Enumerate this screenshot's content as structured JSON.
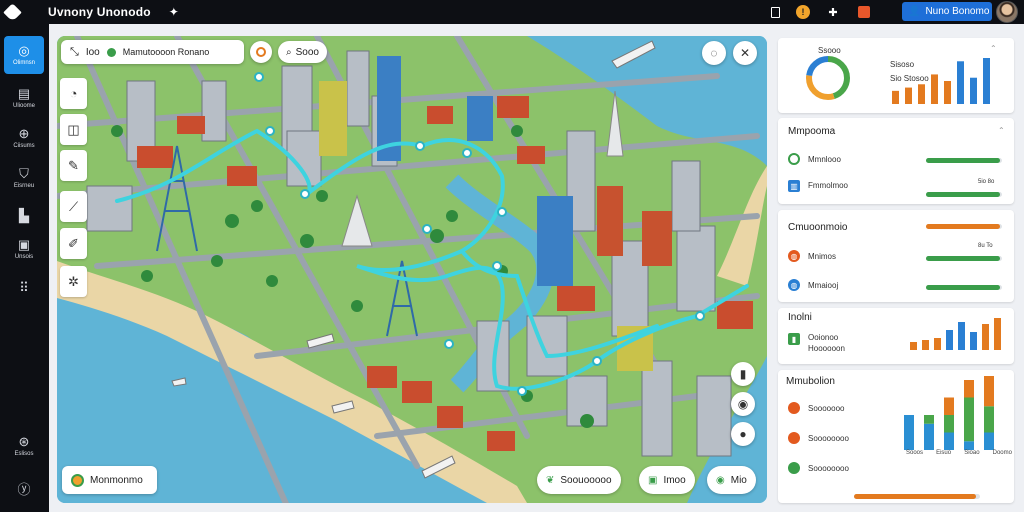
{
  "app": {
    "title": "Uvnony Unonodo",
    "star_icon": "sparkle-icon"
  },
  "topbar": {
    "icons": [
      "window-icon",
      "alert-icon",
      "puzzle-icon",
      "notification-icon"
    ],
    "user_label": "Nuno Bonomo"
  },
  "sidebar": {
    "items": [
      {
        "label": "Olimnsn",
        "icon": "target-icon",
        "active": true
      },
      {
        "label": "Ulioome",
        "icon": "book-icon"
      },
      {
        "label": "Ciisums",
        "icon": "globe-icon"
      },
      {
        "label": "Eisrneu",
        "icon": "shield-icon"
      },
      {
        "label": "",
        "icon": "bookmark-icon"
      },
      {
        "label": "Unsois",
        "icon": "box-icon"
      },
      {
        "label": "",
        "icon": "grid-icon"
      }
    ],
    "bottom": [
      {
        "label": "Eslisos",
        "icon": "settings-icon"
      },
      {
        "label": "",
        "icon": "help-icon"
      }
    ]
  },
  "map": {
    "toolbar": {
      "btn1": "Ioo",
      "location": "Mamutoooon Ronano",
      "search_label": "Sooo"
    },
    "bottom_left": "Monmonmo",
    "bottom_chips": [
      "Soouooooo",
      "Imoo",
      "Mio"
    ]
  },
  "panels": {
    "donut": {
      "label": "Ssooo",
      "stat": "Sisoso",
      "stat_sub": "Sio Stosoo",
      "values": [
        0.45,
        0.32,
        0.23
      ],
      "colors": [
        "#4aa64a",
        "#f0a02e",
        "#2a7fd3"
      ],
      "bars": [
        8,
        10,
        12,
        18,
        14,
        26,
        16,
        28
      ]
    },
    "metrics": {
      "title": "Mmpooma",
      "rows": [
        {
          "label": "Mmnlooo",
          "value": "",
          "progress": 0.98,
          "color": "#3a9d4a"
        },
        {
          "label": "Fmmolmoo",
          "value": "5io 8o",
          "progress": 0.98,
          "color": "#3a9d4a"
        }
      ]
    },
    "connections": {
      "title": "Cmuoonmoio",
      "rows": [
        {
          "label": "",
          "value": "",
          "progress": 0.98,
          "color": "#e37a1f"
        },
        {
          "label": "Mnimos",
          "value": "8u To",
          "progress": 0.98,
          "color": "#3a9d4a"
        },
        {
          "label": "Mmaiooj",
          "value": "",
          "progress": 0.98,
          "color": "#3a9d4a"
        }
      ]
    },
    "stats": {
      "title": "Inolni",
      "label": "Ooionoo",
      "sub": "Hoooooon",
      "bars": [
        4,
        5,
        6,
        10,
        14,
        9,
        13,
        16
      ]
    },
    "breakdown": {
      "title": "Mmubolion",
      "rows": [
        {
          "label": "Sooooooo",
          "color": "#e35a1f"
        },
        {
          "label": "Soooooooo",
          "color": "#e35a1f"
        },
        {
          "label": "Soooooooo",
          "color": "#3a9d4a"
        }
      ],
      "bars": [
        {
          "blue": 40,
          "green": 0,
          "orange": 0
        },
        {
          "blue": 30,
          "green": 10,
          "orange": 0
        },
        {
          "blue": 20,
          "green": 20,
          "orange": 20
        },
        {
          "blue": 10,
          "green": 50,
          "orange": 20
        },
        {
          "blue": 20,
          "green": 30,
          "orange": 35
        }
      ],
      "xlabels": [
        "Sooos",
        "Eisuo",
        "Sioao",
        "Doomo"
      ],
      "footer_progress": 0.97
    }
  }
}
